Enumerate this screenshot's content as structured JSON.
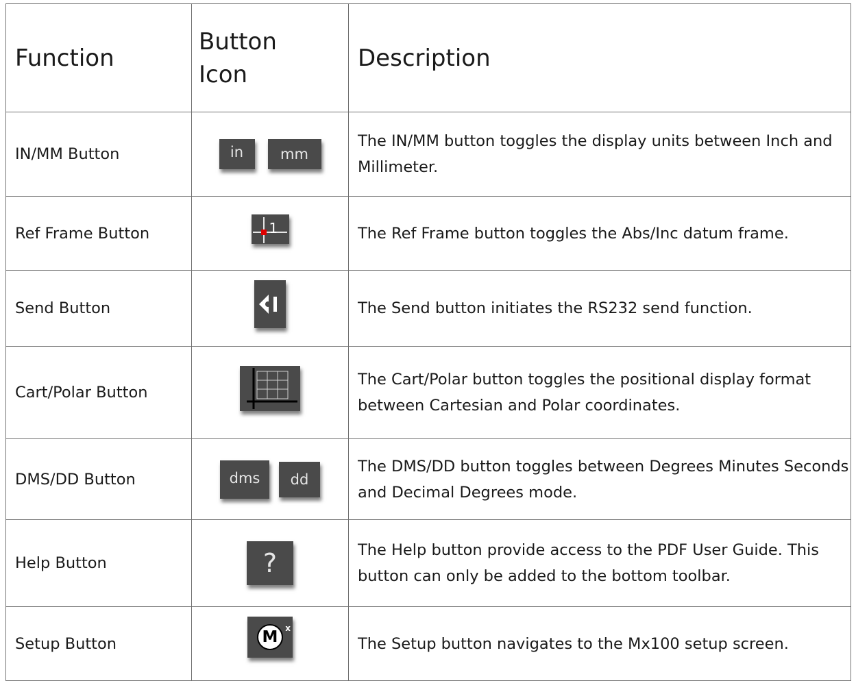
{
  "headers": {
    "function": "Function",
    "icon": "Button Icon",
    "description": "Description"
  },
  "rows": [
    {
      "function": "IN/MM Button",
      "icons": [
        "in",
        "mm"
      ],
      "description": "The IN/MM button toggles the display units between Inch and Millimeter."
    },
    {
      "function": "Ref Frame Button",
      "icons": [
        "ref-frame-icon"
      ],
      "icon_text": "1",
      "description": "The Ref Frame button toggles the Abs/Inc datum frame."
    },
    {
      "function": "Send Button",
      "icons": [
        "send-icon"
      ],
      "description": "The Send button initiates the RS232 send function."
    },
    {
      "function": "Cart/Polar Button",
      "icons": [
        "cart-polar-grid-icon"
      ],
      "description": "The Cart/Polar button toggles the positional display format between Cartesian and Polar coordinates."
    },
    {
      "function": "DMS/DD Button",
      "icons": [
        "dms",
        "dd"
      ],
      "description": "The DMS/DD button toggles between Degrees Minutes Seconds and Decimal Degrees mode."
    },
    {
      "function": "Help Button",
      "icons": [
        "help-icon"
      ],
      "icon_text": "?",
      "description": "The Help button provide access to the PDF User Guide. This button can only be added to the bottom toolbar."
    },
    {
      "function": "Setup Button",
      "icons": [
        "mx-logo-icon"
      ],
      "icon_text": "M",
      "icon_superscript": "x",
      "description": "The Setup button navigates to the Mx100 setup screen."
    }
  ],
  "colors": {
    "button_bg": "#4a4a4a",
    "button_text": "#e6e6e6",
    "ref_point": "#e00000",
    "border": "#707070"
  }
}
